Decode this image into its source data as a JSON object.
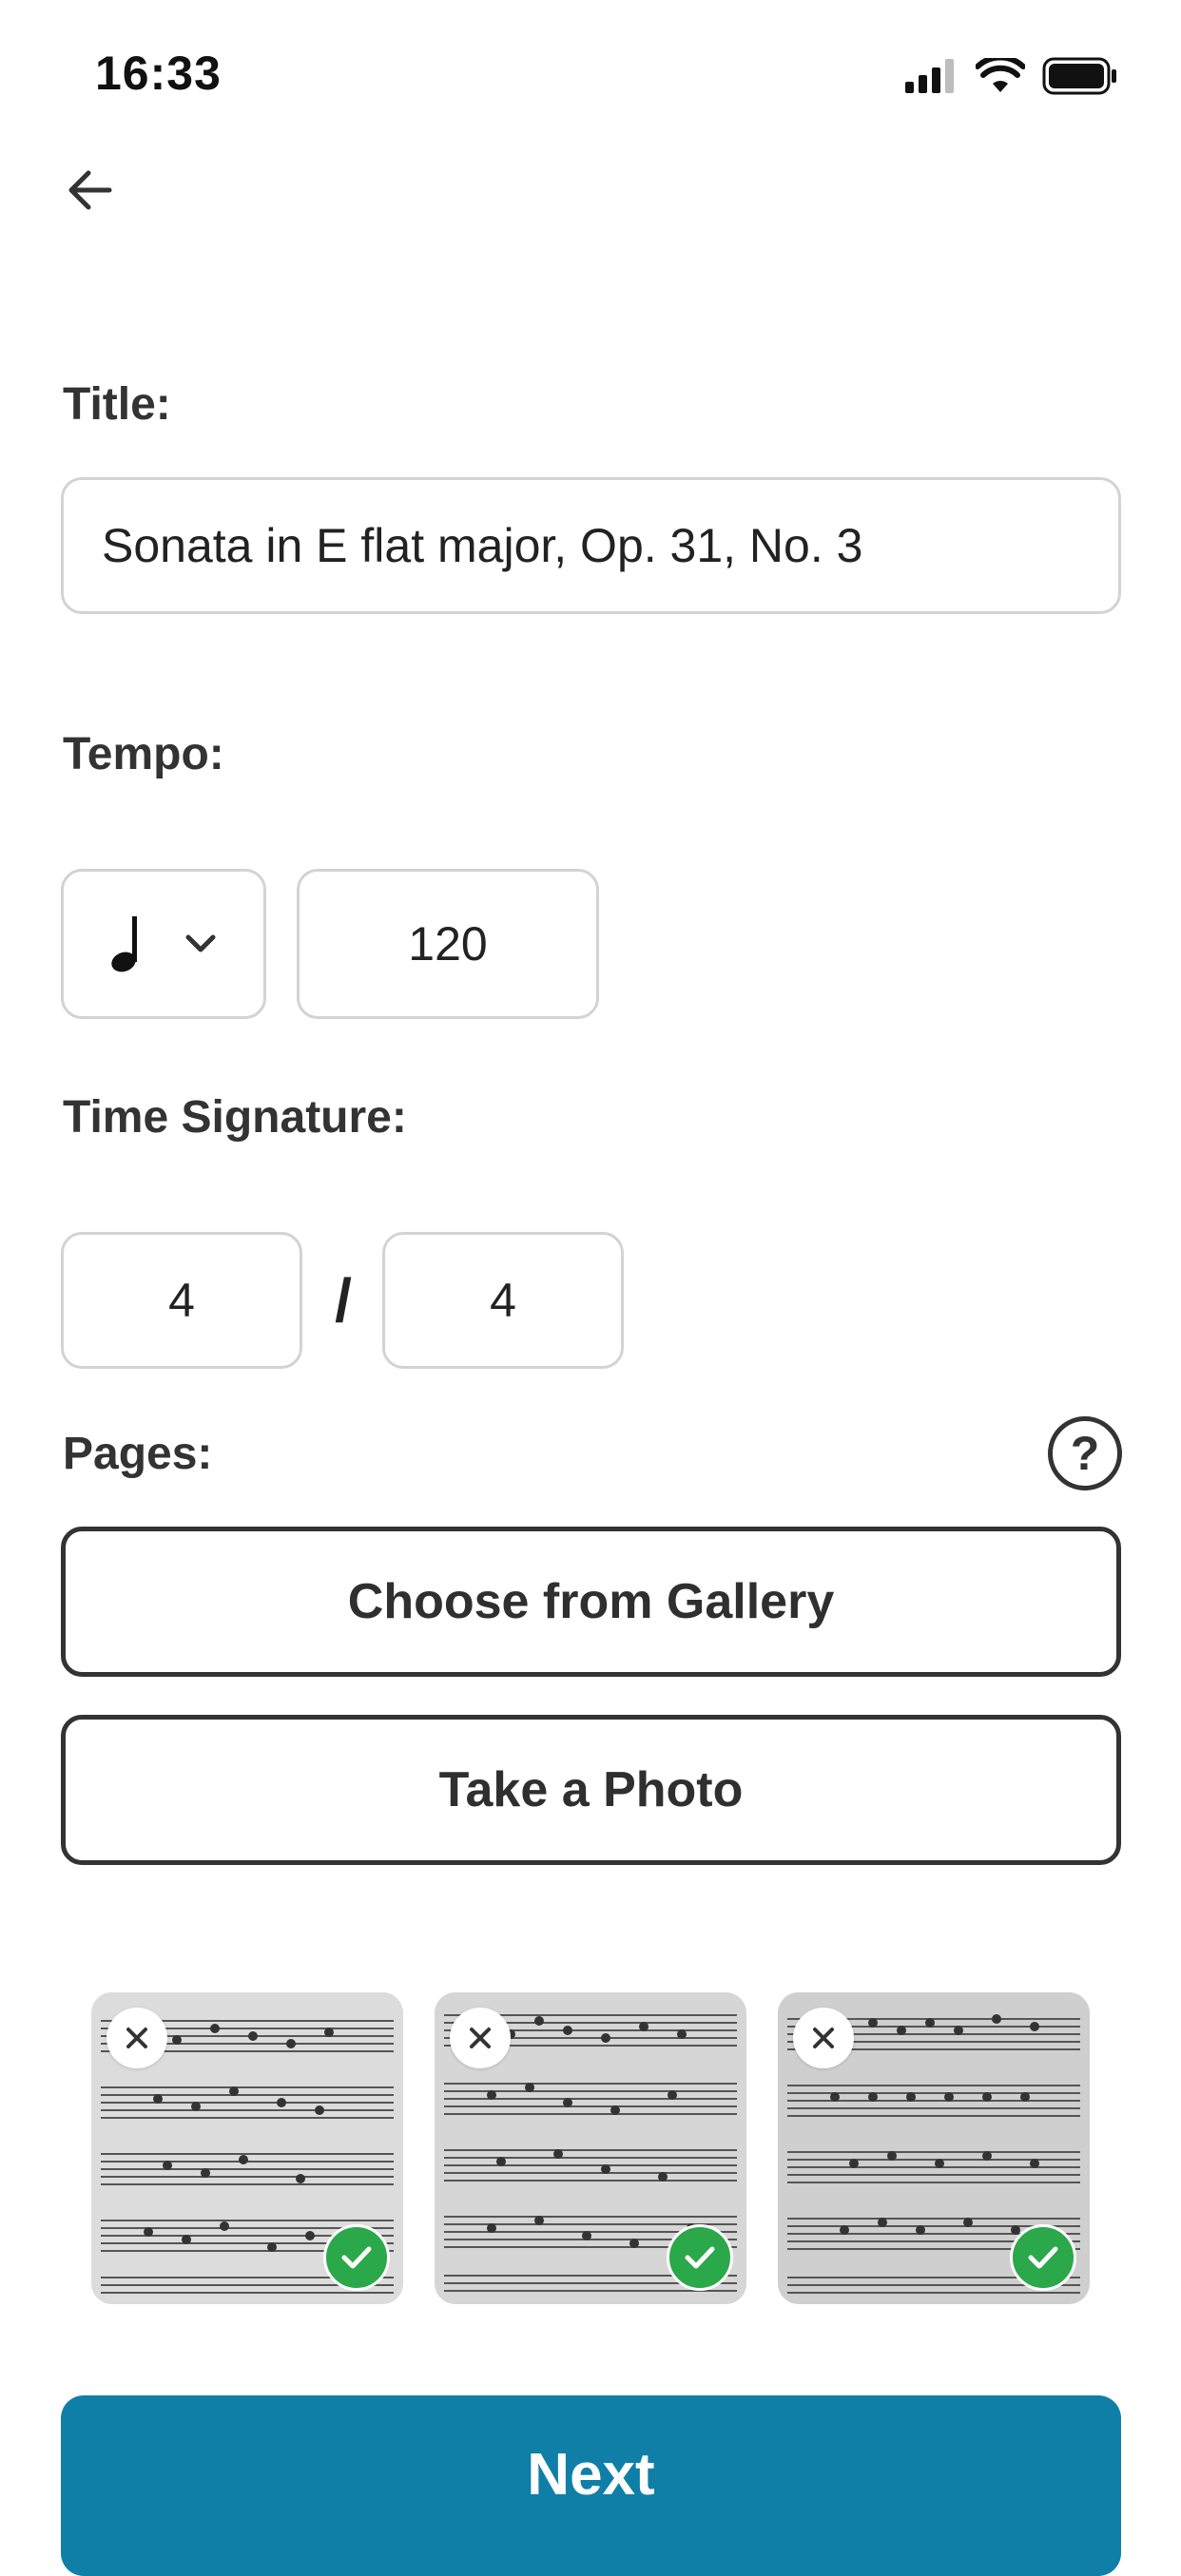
{
  "status_bar": {
    "time": "16:33",
    "icons": [
      "signal-icon",
      "wifi-icon",
      "battery-icon"
    ]
  },
  "nav": {
    "back_icon": "arrow-left-icon"
  },
  "form": {
    "title_label": "Title:",
    "title_value": "Sonata in E flat major, Op. 31, No. 3",
    "tempo_label": "Tempo:",
    "tempo_note": "quarter-note",
    "tempo_value": "120",
    "time_signature_label": "Time Signature:",
    "time_signature_top": "4",
    "time_signature_separator": "/",
    "time_signature_bottom": "4",
    "pages_label": "Pages:",
    "help_icon": "?",
    "choose_gallery_label": "Choose from Gallery",
    "take_photo_label": "Take a Photo"
  },
  "pages": [
    {
      "name": "page-1",
      "selected": true
    },
    {
      "name": "page-2",
      "selected": true
    },
    {
      "name": "page-3",
      "selected": true
    }
  ],
  "next_label": "Next",
  "colors": {
    "primary": "#0f7fa8",
    "check": "#2aa84a",
    "border": "#d3d3d3",
    "outline": "#333333"
  }
}
